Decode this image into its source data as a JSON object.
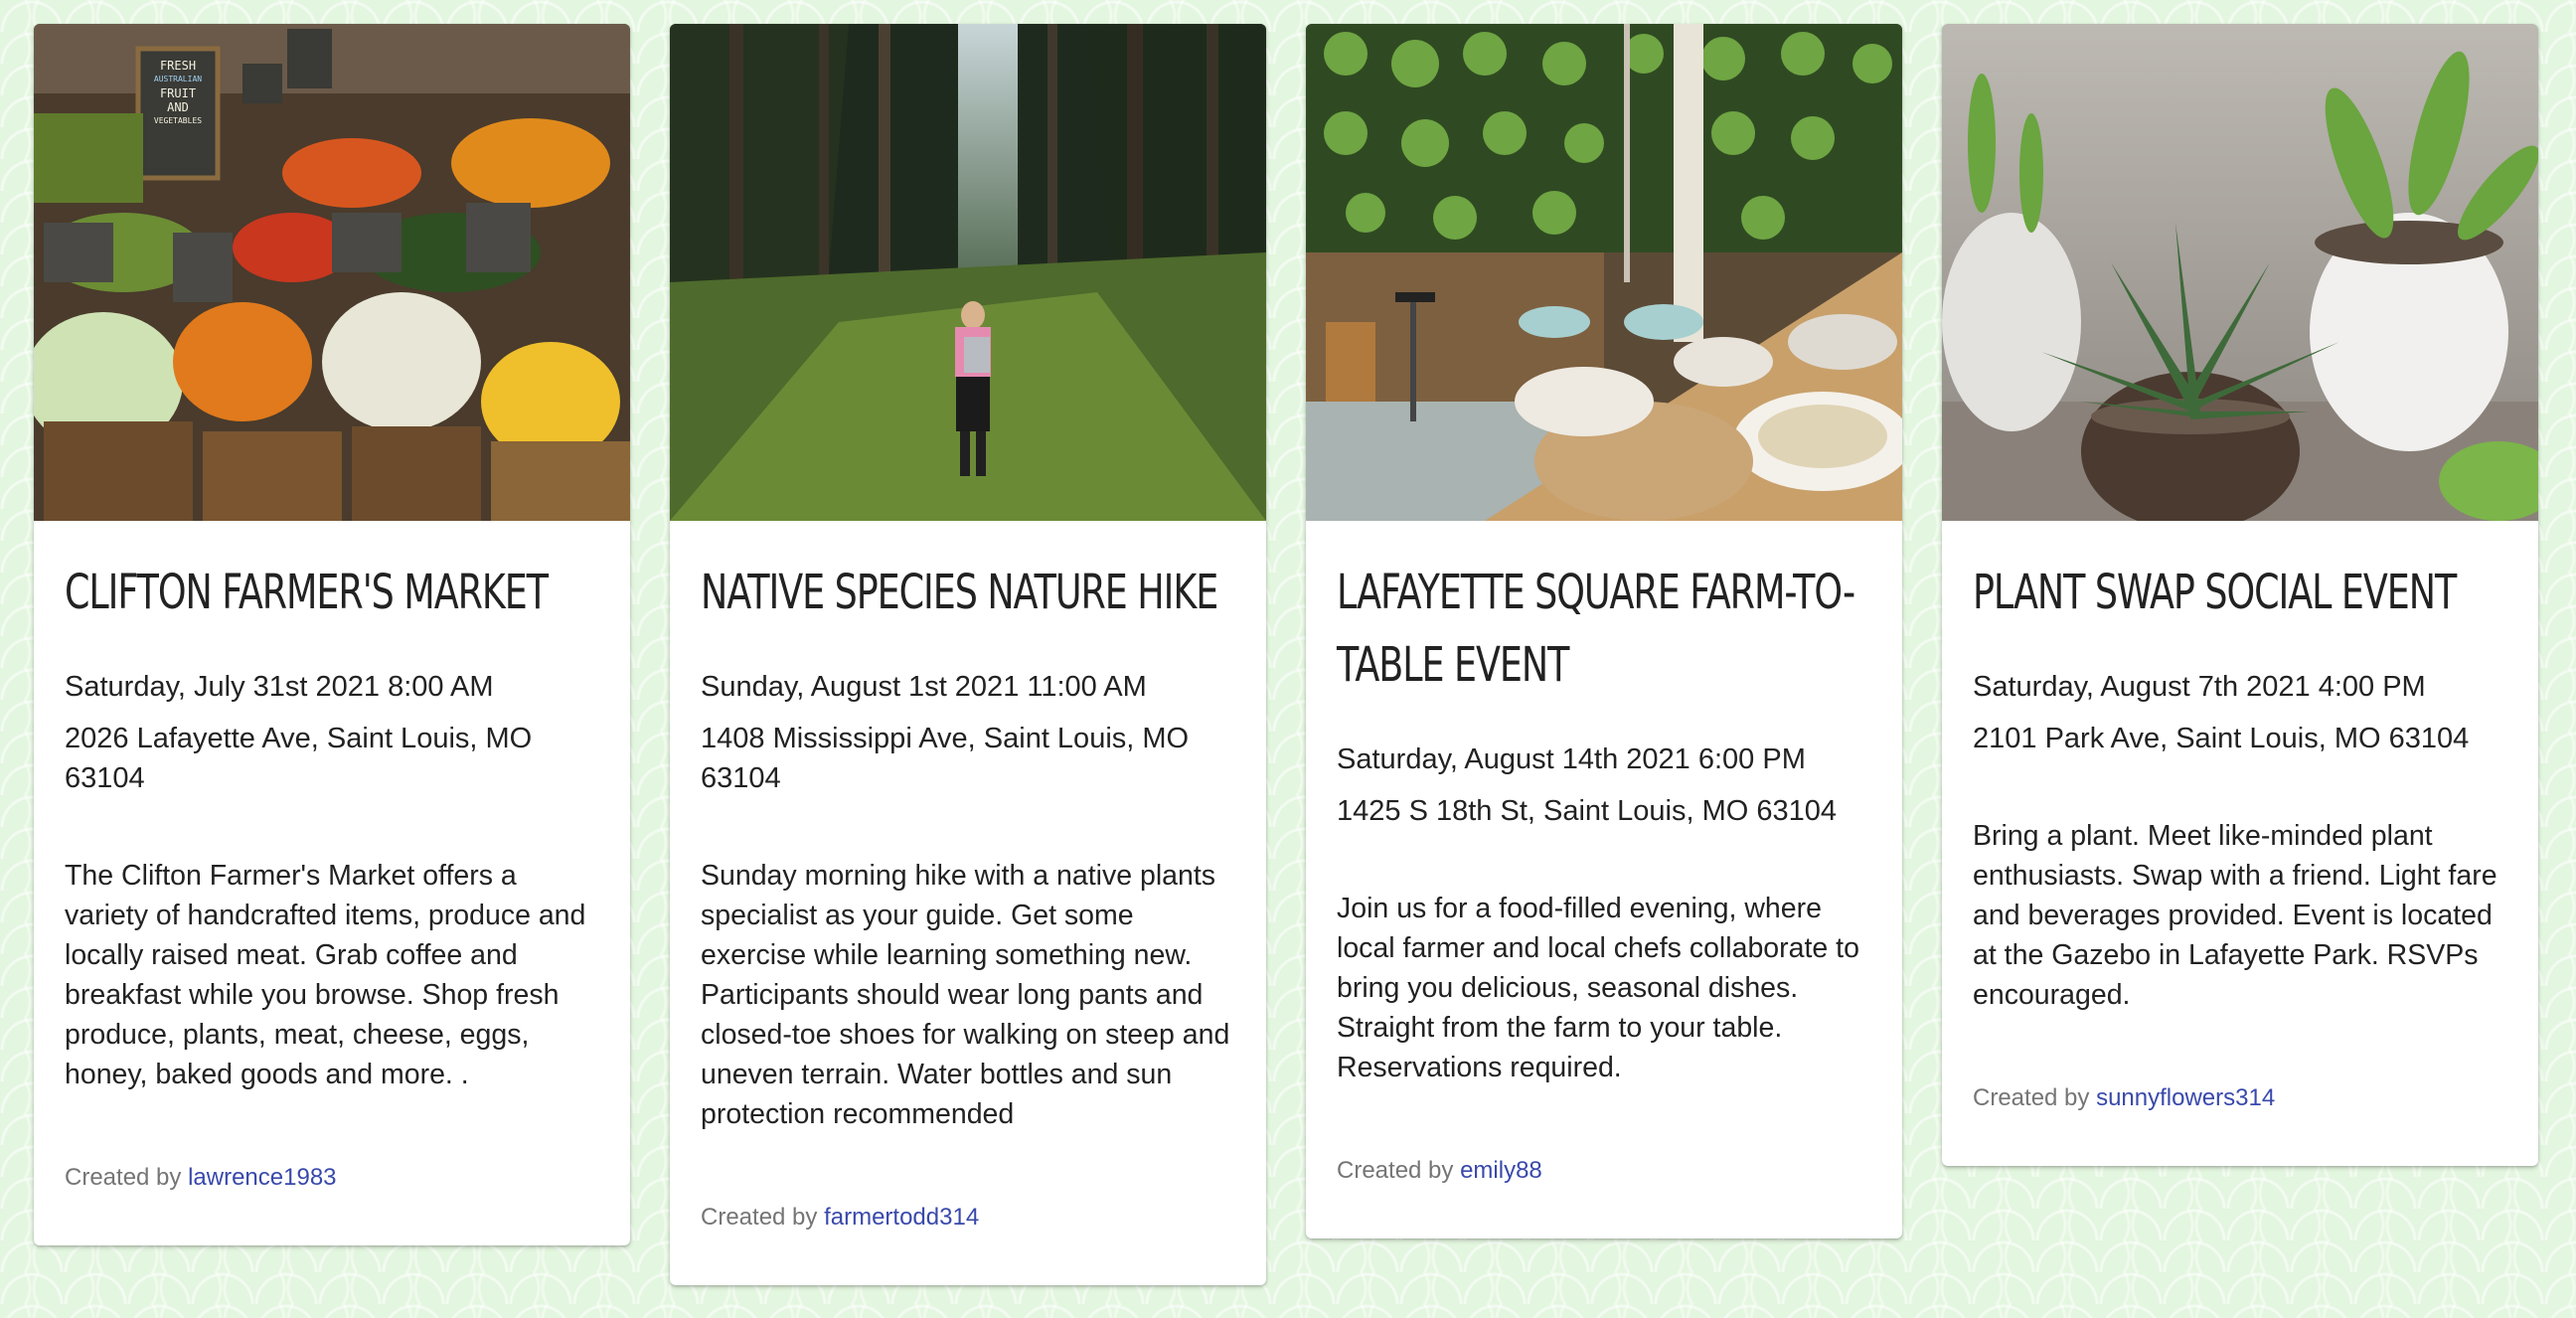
{
  "events": [
    {
      "title": "CLIFTON FARMER'S MARKET",
      "date": "Saturday, July 31st 2021 8:00 AM",
      "address": "2026 Lafayette Ave, Saint Louis, MO 63104",
      "description": "The Clifton Farmer's Market offers a variety of handcrafted items, produce and locally raised meat. Grab coffee and breakfast while you browse. Shop fresh produce, plants, meat, cheese, eggs, honey, baked goods and more. .",
      "created_by_label": "Created by",
      "author": "lawrence1983"
    },
    {
      "title": "NATIVE SPECIES NATURE HIKE",
      "date": "Sunday, August 1st 2021 11:00 AM",
      "address": "1408 Mississippi Ave, Saint Louis, MO 63104",
      "description": "Sunday morning hike with a native plants specialist as your guide. Get some exercise while learning something new. Participants should wear long pants and closed-toe shoes for walking on steep and uneven terrain. Water bottles and sun protection recommended",
      "created_by_label": "Created by",
      "author": "farmertodd314"
    },
    {
      "title": "LAFAYETTE SQUARE FARM-TO-TABLE EVENT",
      "date": "Saturday, August 14th 2021 6:00 PM",
      "address": "1425 S 18th St, Saint Louis, MO 63104",
      "description": "Join us for a food-filled evening, where local farmer and local chefs collaborate to bring you delicious, seasonal dishes. Straight from the farm to your table. Reservations required.",
      "created_by_label": "Created by",
      "author": "emily88"
    },
    {
      "title": "PLANT SWAP SOCIAL EVENT",
      "date": "Saturday, August 7th 2021 4:00 PM",
      "address": "2101 Park Ave, Saint Louis, MO 63104",
      "description": "Bring a plant. Meet like-minded plant enthusiasts. Swap with a friend. Light fare and beverages provided. Event is located at the Gazebo in Lafayette Park. RSVPs encouraged.",
      "created_by_label": "Created by",
      "author": "sunnyflowers314"
    }
  ],
  "colors": {
    "page_background": "#e3f6df",
    "card_background": "#ffffff",
    "text": "#222222",
    "muted_text": "#757575",
    "link": "#3949ab"
  },
  "images": {
    "chalkboard_sign_text": [
      "FRESH",
      "AUSTRALIAN",
      "FRUIT",
      "AND",
      "VEGETABLES"
    ]
  }
}
